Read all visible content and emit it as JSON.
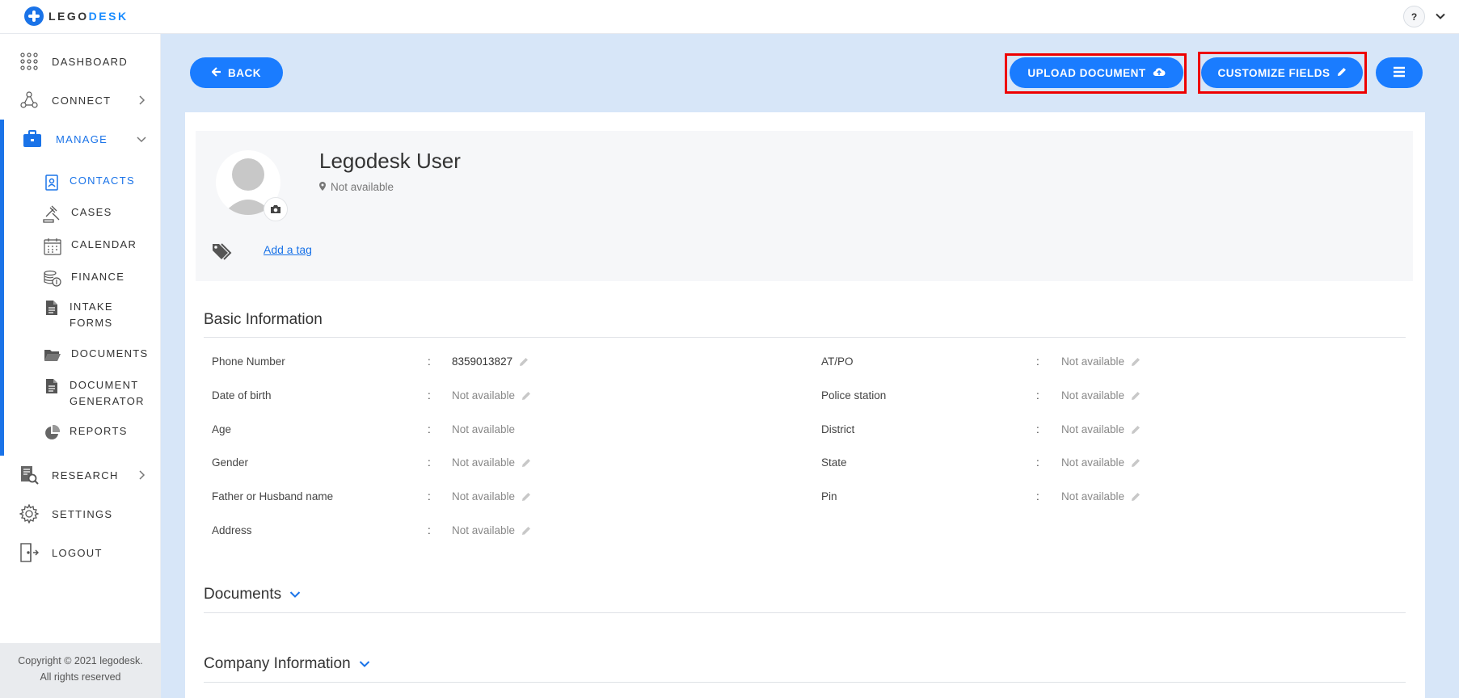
{
  "app": {
    "logo_part1": "LEGO",
    "logo_part2": "DESK"
  },
  "topbar": {
    "help_label": "?"
  },
  "sidebar": {
    "items": [
      {
        "label": "DASHBOARD",
        "icon": "grid-icon"
      },
      {
        "label": "CONNECT",
        "icon": "network-icon"
      },
      {
        "label": "MANAGE",
        "icon": "briefcase-icon"
      },
      {
        "label": "RESEARCH",
        "icon": "research-icon"
      },
      {
        "label": "SETTINGS",
        "icon": "gear-icon"
      },
      {
        "label": "LOGOUT",
        "icon": "logout-icon"
      }
    ],
    "manage_items": [
      {
        "label": "CONTACTS",
        "icon": "contact-card-icon"
      },
      {
        "label": "CASES",
        "icon": "gavel-icon"
      },
      {
        "label": "CALENDAR",
        "icon": "calendar-icon"
      },
      {
        "label": "FINANCE",
        "icon": "coins-icon"
      },
      {
        "label_line1": "INTAKE",
        "label_line2": "FORMS",
        "icon": "document-icon"
      },
      {
        "label": "DOCUMENTS",
        "icon": "folder-icon"
      },
      {
        "label_line1": "DOCUMENT",
        "label_line2": "GENERATOR",
        "icon": "document-icon"
      },
      {
        "label": "REPORTS",
        "icon": "pie-chart-icon"
      }
    ],
    "copyright_line1": "Copyright © 2021 legodesk.",
    "copyright_line2": "All rights reserved"
  },
  "toolbar": {
    "back_label": "BACK",
    "upload_label": "UPLOAD DOCUMENT",
    "customize_label": "CUSTOMIZE FIELDS"
  },
  "profile": {
    "name": "Legodesk User",
    "location": "Not available",
    "add_tag_label": "Add a tag"
  },
  "sections": {
    "basic_title": "Basic Information",
    "documents_title": "Documents",
    "company_title": "Company Information"
  },
  "basic_info": {
    "separator": ":",
    "left": [
      {
        "label": "Phone Number",
        "value": "8359013827"
      },
      {
        "label": "Date of birth",
        "value": "Not available"
      },
      {
        "label": "Age",
        "value": "Not available"
      },
      {
        "label": "Gender",
        "value": "Not available"
      },
      {
        "label": "Father or Husband name",
        "value": "Not available"
      },
      {
        "label": "Address",
        "value": "Not available"
      }
    ],
    "right": [
      {
        "label": "AT/PO",
        "value": "Not available"
      },
      {
        "label": "Police station",
        "value": "Not available"
      },
      {
        "label": "District",
        "value": "Not available"
      },
      {
        "label": "State",
        "value": "Not available"
      },
      {
        "label": "Pin",
        "value": "Not available"
      }
    ]
  },
  "colors": {
    "accent": "#1a7cff",
    "highlight": "#ee0000",
    "main_bg": "#d7e6f8"
  }
}
